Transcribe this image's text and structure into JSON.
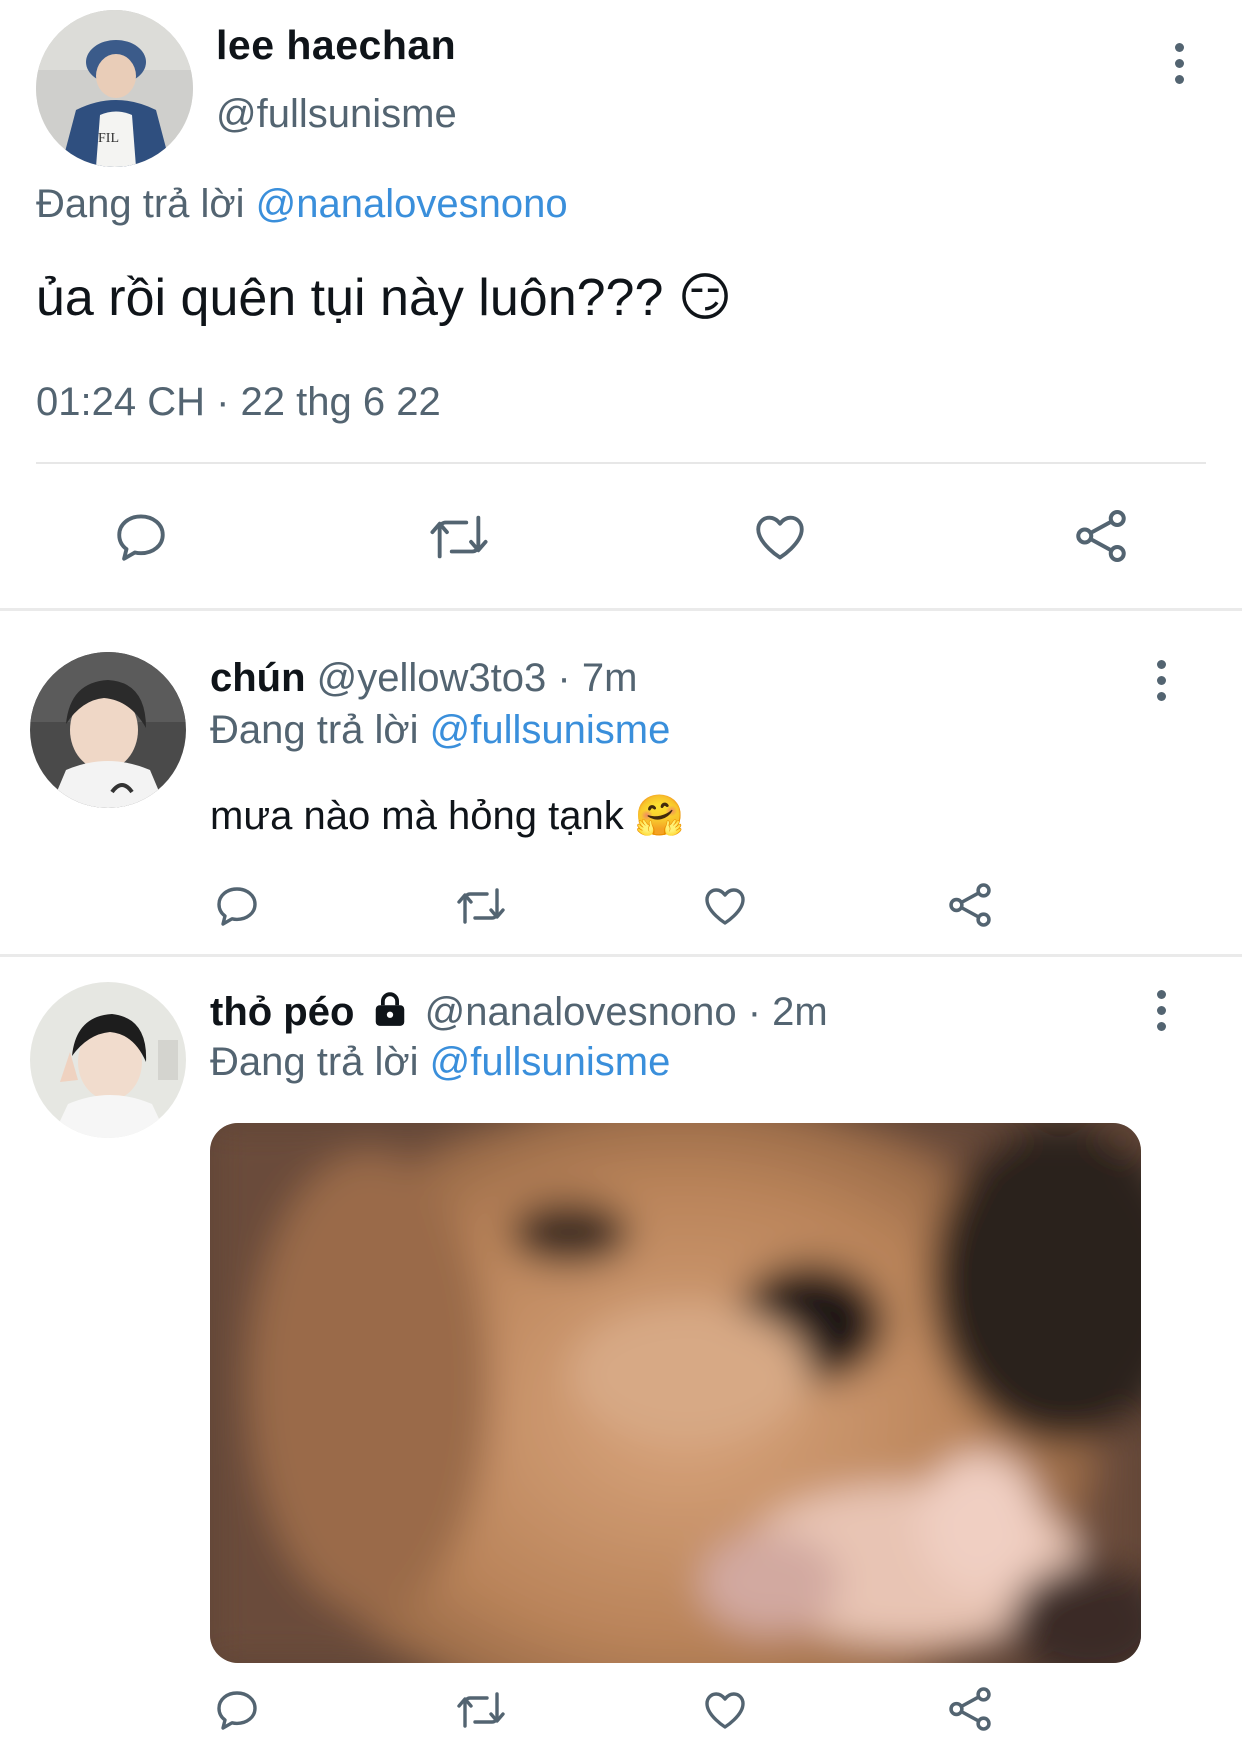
{
  "main_tweet": {
    "display_name": "lee haechan",
    "handle": "@fullsunisme",
    "replying_prefix": "Đang trả lời",
    "replying_to": "@nanalovesnono",
    "text": "ủa rồi quên tụi này luôn???",
    "emoji": "😏",
    "timestamp": "01:24 CH · 22 thg 6 22"
  },
  "replies": [
    {
      "display_name": "chún",
      "handle": "@yellow3to3",
      "time": "· 7m",
      "replying_prefix": "Đang trả lời",
      "replying_to": "@fullsunisme",
      "text": "mưa nào mà hỏng tạnk",
      "emoji": "🤗"
    },
    {
      "display_name": "thỏ péo",
      "lock_icon": "lock-icon",
      "handle": "@nanalovesnono",
      "time": "· 2m",
      "replying_prefix": "Đang trả lời",
      "replying_to": "@fullsunisme",
      "has_media": true
    }
  ],
  "icons": {
    "reply": "reply-icon",
    "retweet": "retweet-icon",
    "like": "heart-icon",
    "share": "share-icon",
    "more": "more-options-icon"
  },
  "colors": {
    "mention": "#3a8fdb",
    "secondary_text": "#536471",
    "icon": "#536471"
  }
}
